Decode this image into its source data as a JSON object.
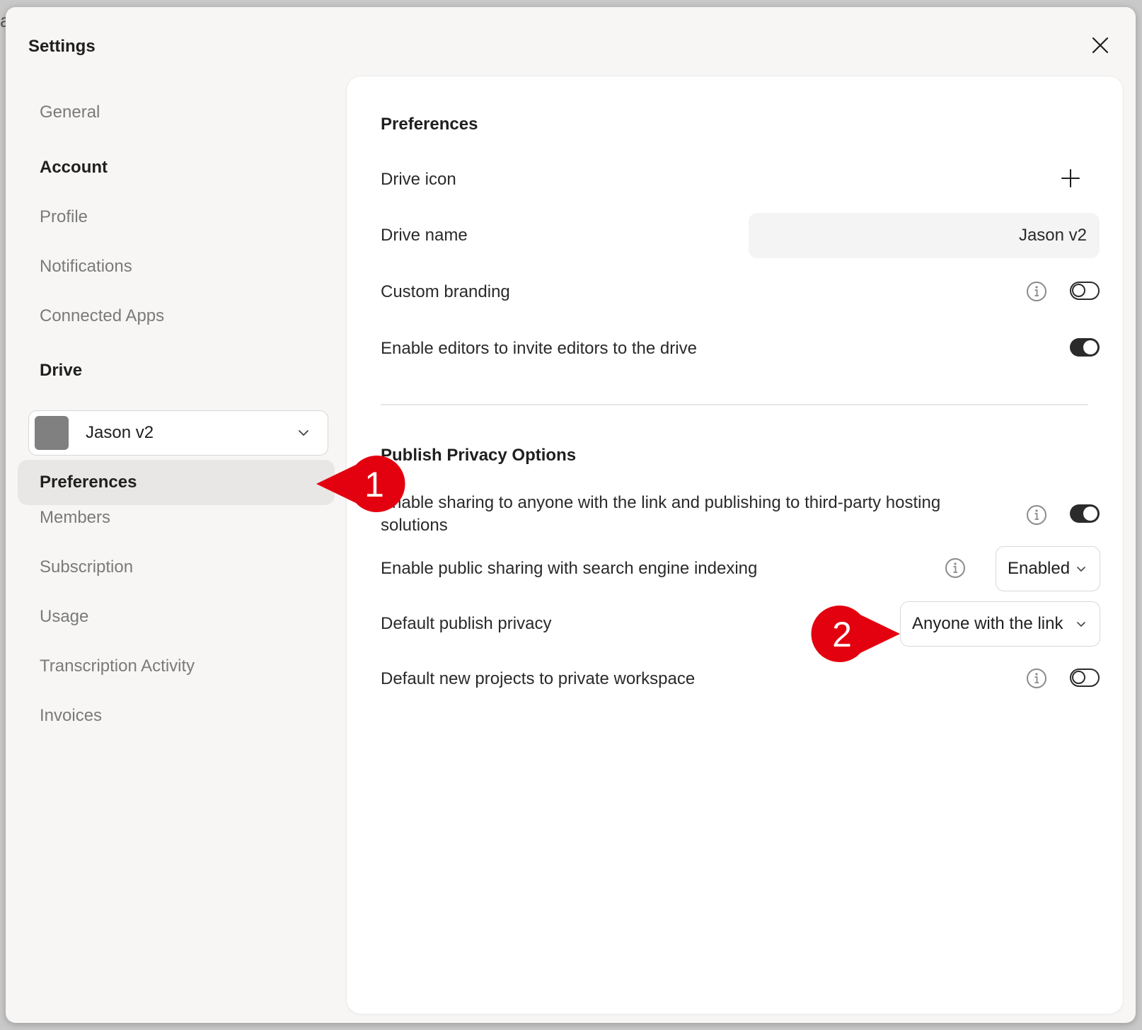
{
  "window": {
    "title": "Settings"
  },
  "sidebar": {
    "general": "General",
    "account_heading": "Account",
    "profile": "Profile",
    "notifications": "Notifications",
    "connected_apps": "Connected Apps",
    "drive_heading": "Drive",
    "drive_select": {
      "name": "Jason v2"
    },
    "preferences": "Preferences",
    "members": "Members",
    "subscription": "Subscription",
    "usage": "Usage",
    "transcription_activity": "Transcription Activity",
    "invoices": "Invoices"
  },
  "panel": {
    "preferences_title": "Preferences",
    "drive_icon_label": "Drive icon",
    "drive_name_label": "Drive name",
    "drive_name_value": "Jason v2",
    "custom_branding_label": "Custom branding",
    "custom_branding_enabled": false,
    "invite_editors_label": "Enable editors to invite editors to the drive",
    "invite_editors_enabled": true,
    "publish_title": "Publish Privacy Options",
    "sharing_label": "Enable sharing to anyone with the link and publishing to third-party hosting solutions",
    "sharing_enabled": true,
    "search_indexing_label": "Enable public sharing with search engine indexing",
    "search_indexing_value": "Enabled",
    "default_privacy_label": "Default publish privacy",
    "default_privacy_value": "Anyone with the link",
    "private_workspace_label": "Default new projects to private workspace",
    "private_workspace_enabled": false
  },
  "annotations": {
    "callout_1": "1",
    "callout_2": "2",
    "color": "#e3000f"
  },
  "icons": {
    "close": "close-icon",
    "plus": "plus-icon",
    "info": "info-icon",
    "chevron": "chevron-down-icon"
  }
}
